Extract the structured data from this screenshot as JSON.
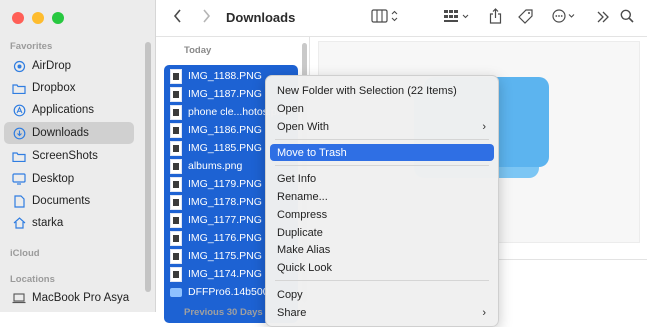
{
  "window": {
    "title": "Downloads"
  },
  "traffic_lights": {
    "close": "#ff5f57",
    "minimize": "#febc2e",
    "zoom": "#28c840"
  },
  "sidebar": {
    "favorites_header": "Favorites",
    "icloud_header": "iCloud",
    "locations_header": "Locations",
    "items": [
      {
        "label": "AirDrop",
        "icon": "airdrop-icon",
        "selected": false
      },
      {
        "label": "Dropbox",
        "icon": "folder-icon",
        "selected": false
      },
      {
        "label": "Applications",
        "icon": "applications-icon",
        "selected": false
      },
      {
        "label": "Downloads",
        "icon": "downloads-icon",
        "selected": true
      },
      {
        "label": "ScreenShots",
        "icon": "folder-icon",
        "selected": false
      },
      {
        "label": "Desktop",
        "icon": "desktop-icon",
        "selected": false
      },
      {
        "label": "Documents",
        "icon": "document-icon",
        "selected": false
      },
      {
        "label": "starka",
        "icon": "home-icon",
        "selected": false
      }
    ],
    "locations": [
      {
        "label": "MacBook Pro Asya",
        "icon": "laptop-icon"
      }
    ]
  },
  "file_list": {
    "group_today": "Today",
    "group_prev": "Previous 30 Days",
    "files": [
      {
        "name": "IMG_1188.PNG"
      },
      {
        "name": "IMG_1187.PNG"
      },
      {
        "name": "phone cle...hotos.png"
      },
      {
        "name": "IMG_1186.PNG"
      },
      {
        "name": "IMG_1185.PNG"
      },
      {
        "name": "albums.png"
      },
      {
        "name": "IMG_1179.PNG"
      },
      {
        "name": "IMG_1178.PNG"
      },
      {
        "name": "IMG_1177.PNG"
      },
      {
        "name": "IMG_1176.PNG"
      },
      {
        "name": "IMG_1175.PNG"
      },
      {
        "name": "IMG_1174.PNG"
      },
      {
        "name": "DFFPro6.14b500",
        "folder": true
      }
    ]
  },
  "context_menu": {
    "items": [
      {
        "label": "New Folder with Selection (22 Items)"
      },
      {
        "label": "Open"
      },
      {
        "label": "Open With",
        "submenu": true
      },
      {
        "label": "Move to Trash",
        "highlighted": true
      },
      {
        "label": "Get Info"
      },
      {
        "label": "Rename..."
      },
      {
        "label": "Compress"
      },
      {
        "label": "Duplicate"
      },
      {
        "label": "Make Alias"
      },
      {
        "label": "Quick Look"
      },
      {
        "label": "Copy"
      },
      {
        "label": "Share",
        "submenu": true
      }
    ]
  },
  "colors": {
    "accent": "#1d62d3",
    "menu_highlight": "#2f6fe4",
    "sidebar_icon": "#2f7de1"
  }
}
